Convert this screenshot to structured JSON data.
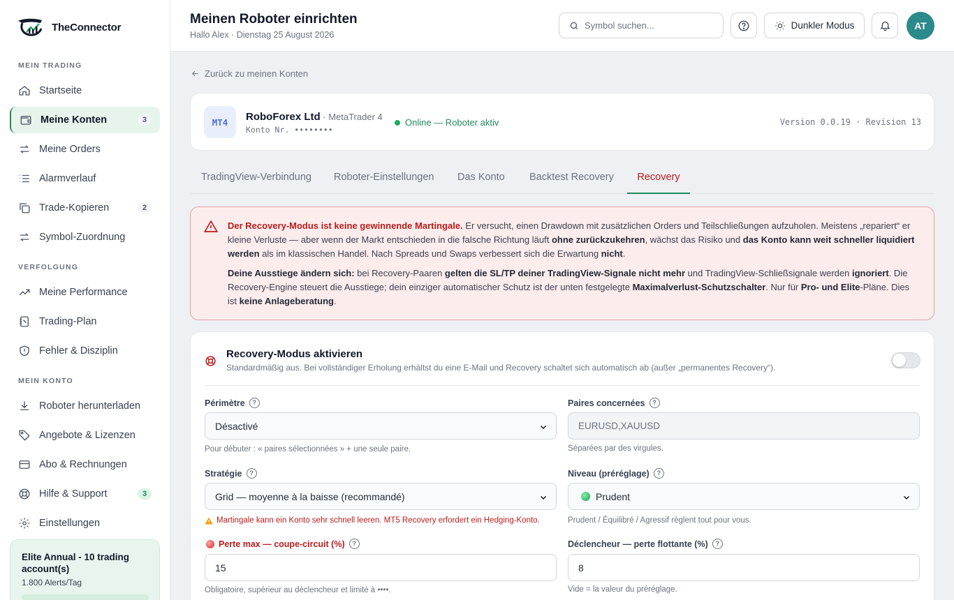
{
  "brand": {
    "name": "TheConnector"
  },
  "sidebar": {
    "sections": [
      "MEIN TRADING",
      "VERFOLGUNG",
      "MEIN KONTO"
    ],
    "items": [
      {
        "label": "Startseite",
        "icon": "home-icon"
      },
      {
        "label": "Meine Konten",
        "icon": "wallet-icon",
        "badge": "3"
      },
      {
        "label": "Meine Orders",
        "icon": "arrows-swap-icon"
      },
      {
        "label": "Alarmverlauf",
        "icon": "list-icon"
      },
      {
        "label": "Trade-Kopieren",
        "icon": "copy-icon",
        "badge": "2"
      },
      {
        "label": "Symbol-Zuordnung",
        "icon": "arrows-swap-icon"
      },
      {
        "label": "Meine Performance",
        "icon": "trend-up-icon"
      },
      {
        "label": "Trading-Plan",
        "icon": "notebook-icon"
      },
      {
        "label": "Fehler & Disziplin",
        "icon": "shield-icon"
      },
      {
        "label": "Roboter herunterladen",
        "icon": "download-icon"
      },
      {
        "label": "Angebote & Lizenzen",
        "icon": "tag-icon"
      },
      {
        "label": "Abo & Rechnungen",
        "icon": "credit-card-icon"
      },
      {
        "label": "Hilfe & Support",
        "icon": "lifebuoy-icon",
        "badge": "3"
      },
      {
        "label": "Einstellungen",
        "icon": "gear-icon"
      }
    ],
    "plan": {
      "title": "Elite Annual - 10 trading account(s)",
      "sub": "1.800 Alerts/Tag"
    }
  },
  "header": {
    "title": "Meinen Roboter einrichten",
    "subtitle": "Hallo Alex · Dienstag 25 August 2026",
    "search_placeholder": "Symbol suchen...",
    "dark_mode": "Dunkler Modus",
    "avatar": "AT"
  },
  "back_link": "Zurück zu meinen Konten",
  "account": {
    "badge": "MT4",
    "broker": "RoboForex Ltd",
    "platform": " · MetaTrader 4",
    "number": "Konto Nr. ••••••••",
    "status": "Online — Roboter aktiv",
    "version": "Version 0.0.19 · Revision 13"
  },
  "tabs": [
    "TradingView-Verbindung",
    "Roboter-Einstellungen",
    "Das Konto",
    "Backtest Recovery",
    "Recovery"
  ],
  "warning": {
    "p1": [
      {
        "t": "Der Recovery-Modus ist keine gewinnende Martingale.",
        "s": "red"
      },
      {
        "t": " Er versucht, einen Drawdown mit zusätzlichen Orders und Teilschließungen aufzuholen. Meistens „repariert“ er kleine Verluste — aber wenn der Markt entschieden in die falsche Richtung läuft "
      },
      {
        "t": "ohne zurückzukehren",
        "s": "b"
      },
      {
        "t": ", wächst das Risiko und "
      },
      {
        "t": "das Konto kann weit schneller liquidiert werden",
        "s": "b"
      },
      {
        "t": " als im klassischen Handel. Nach Spreads und Swaps verbessert sich die Erwartung "
      },
      {
        "t": "nicht",
        "s": "b"
      },
      {
        "t": "."
      }
    ],
    "p2": [
      {
        "t": "Deine Ausstiege ändern sich:",
        "s": "b"
      },
      {
        "t": " bei Recovery-Paaren "
      },
      {
        "t": "gelten die SL/TP deiner TradingView-Signale nicht mehr",
        "s": "b"
      },
      {
        "t": " und TradingView-Schließsignale werden "
      },
      {
        "t": "ignoriert",
        "s": "b"
      },
      {
        "t": ". Die Recovery-Engine steuert die Ausstiege; dein einziger automatischer Schutz ist der unten festgelegte "
      },
      {
        "t": "Maximalverlust-Schutzschalter",
        "s": "b"
      },
      {
        "t": ". Nur für "
      },
      {
        "t": "Pro- und Elite",
        "s": "b"
      },
      {
        "t": "-Pläne. Dies ist "
      },
      {
        "t": "keine Anlageberatung",
        "s": "b"
      },
      {
        "t": "."
      }
    ]
  },
  "recovery": {
    "title": "Recovery-Modus aktivieren",
    "subtitle": "Standardmäßig aus. Bei vollständiger Erholung erhältst du eine E-Mail und Recovery schaltet sich automatisch ab (außer „permanentes Recovery“).",
    "enabled": false,
    "fields": {
      "perimetre": {
        "label": "Périmètre",
        "value": "Désactivé",
        "help": "Pour débuter : « paires sélectionnées » + une seule paire."
      },
      "paires": {
        "label": "Paires concernées",
        "placeholder": "EURUSD,XAUUSD",
        "help": "Séparées par des virgules."
      },
      "strategie": {
        "label": "Stratégie",
        "value": "Grid — moyenne à la baisse (recommandé)",
        "help": "Martingale kann ein Konto sehr schnell leeren. MT5 Recovery erfordert ein Hedging-Konto."
      },
      "niveau": {
        "label": "Niveau (préréglage)",
        "value": "Prudent",
        "help": "Prudent / Équilibré / Agressif règlent tout pour vous."
      },
      "perte_max": {
        "label": "Perte max — coupe-circuit (%)",
        "value": "15",
        "help": "Obligatoire, supérieur au déclencheur et limité à ••••."
      },
      "declencheur": {
        "label": "Déclencheur — perte flottante (%)",
        "value": "8",
        "help": "Vide = la valeur du préréglage."
      }
    }
  },
  "colors": {
    "accent_green": "#1f8a5b",
    "danger_red": "#b91c1c",
    "avatar_bg": "#2b8a8a"
  }
}
